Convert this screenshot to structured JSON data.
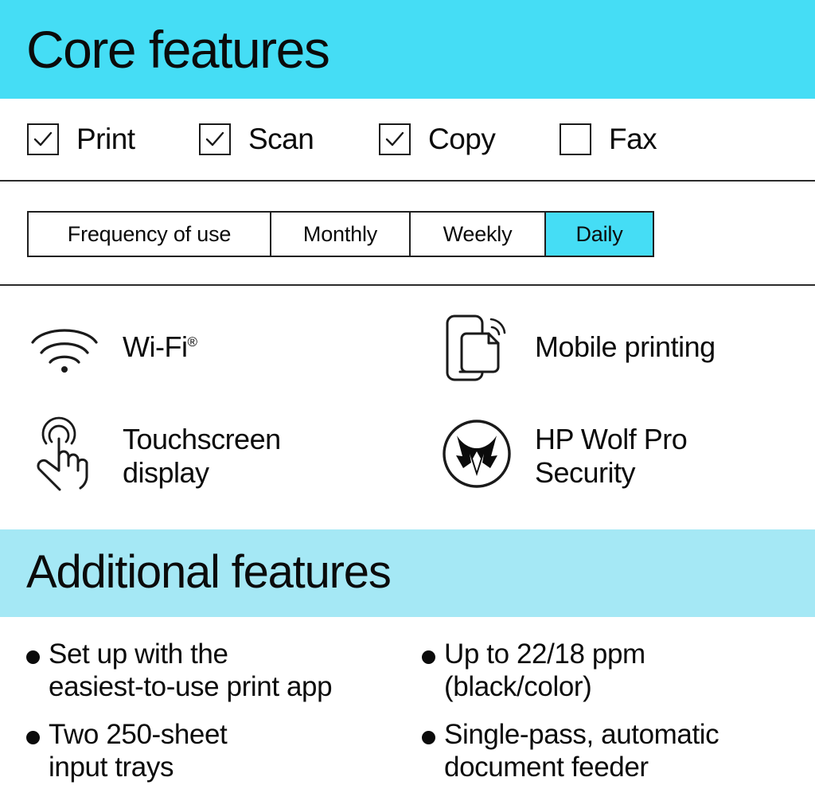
{
  "colors": {
    "core_banner_bg": "#45DDF5",
    "additional_banner_bg": "#A5E8F5",
    "active_segment_bg": "#45DDF5",
    "text": "#0b0b0b",
    "rule": "#2b2b2b"
  },
  "core_section": {
    "title": "Core features",
    "capabilities": [
      {
        "label": "Print",
        "checked": true,
        "icon": "checkbox-checked-icon"
      },
      {
        "label": "Scan",
        "checked": true,
        "icon": "checkbox-checked-icon"
      },
      {
        "label": "Copy",
        "checked": true,
        "icon": "checkbox-checked-icon"
      },
      {
        "label": "Fax",
        "checked": false,
        "icon": "checkbox-unchecked-icon"
      }
    ],
    "frequency": {
      "row_label": "Frequency of use",
      "options": [
        {
          "label": "Monthly",
          "selected": false
        },
        {
          "label": "Weekly",
          "selected": false
        },
        {
          "label": "Daily",
          "selected": true
        }
      ],
      "selected": "Daily"
    },
    "features": [
      {
        "caption": "Wi-Fi",
        "trademark": "®",
        "icon": "wifi-icon"
      },
      {
        "caption": "Mobile printing",
        "trademark": "",
        "icon": "mobile-printing-icon"
      },
      {
        "caption": "Touchscreen\ndisplay",
        "trademark": "",
        "icon": "touchscreen-icon"
      },
      {
        "caption": "HP Wolf Pro\nSecurity",
        "trademark": "",
        "icon": "hp-wolf-security-icon"
      }
    ]
  },
  "additional_section": {
    "title": "Additional features",
    "bullets": [
      "Set up with the\neasiest-to-use print app",
      "Up to 22/18 ppm\n(black/color)",
      "Two 250-sheet\ninput trays",
      "Single-pass, automatic\ndocument feeder"
    ]
  }
}
